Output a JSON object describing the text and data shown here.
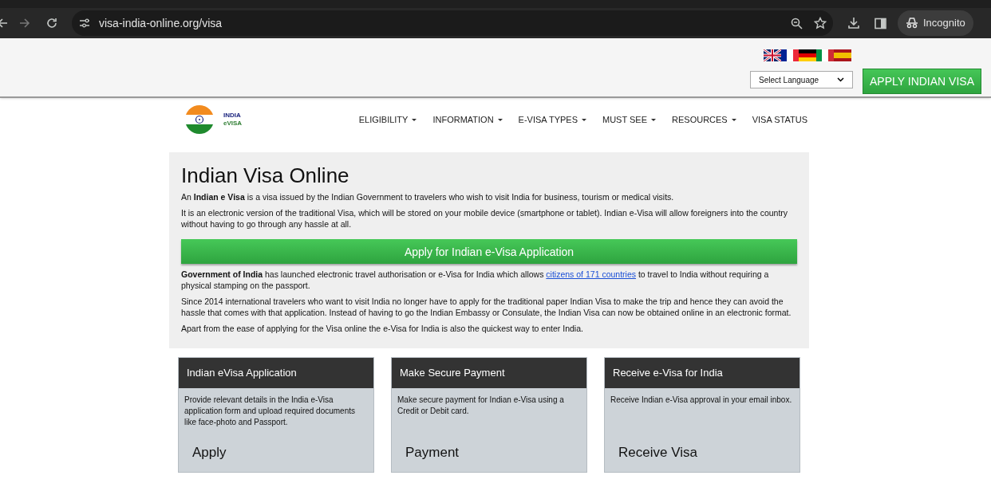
{
  "browser": {
    "url": "visa-india-online.org/visa",
    "profile": "Incognito"
  },
  "header": {
    "language_select": "Select Language",
    "apply_button": "APPLY INDIAN VISA"
  },
  "logo": {
    "line_1": "INDIA",
    "line_2": "eVISA"
  },
  "nav": [
    {
      "label": "ELIGIBILITY",
      "dropdown": true
    },
    {
      "label": "INFORMATION",
      "dropdown": true
    },
    {
      "label": "E-VISA TYPES",
      "dropdown": true
    },
    {
      "label": "MUST SEE",
      "dropdown": true
    },
    {
      "label": "RESOURCES",
      "dropdown": true
    },
    {
      "label": "VISA STATUS",
      "dropdown": false
    }
  ],
  "intro": {
    "title": "Indian Visa Online",
    "paragraphs_top": [
      "An **Indian e Visa** is a visa issued by the Indian Government to travelers who wish to visit India for business, tourism or medical visits.",
      "It is an electronic version of the traditional Visa, which will be stored on your mobile device (smartphone or tablet). Indian e-Visa will allow foreigners into the country without having to go through any hassle at all."
    ],
    "apply_button": "Apply for Indian e-Visa Application",
    "link_paragraph": {
      "before": "**Government of India** has launched electronic travel authorisation or e-Visa for India which allows ",
      "link": "citizens of 171 countries",
      "after": " to travel to India without requiring a physical stamping on the passport."
    },
    "paragraphs_bottom": [
      "Since 2014 international travelers who want to visit India no longer have to apply for the traditional paper Indian Visa to make the trip and hence they can avoid the hassle that comes with that application. Instead of having to go the Indian Embassy or Consulate, the Indian Visa can now be obtained online in an electronic format.",
      "Apart from the ease of applying for the Visa online the e-Visa for India is also the quickest way to enter India."
    ]
  },
  "steps": [
    {
      "title": "Indian eVisa Application",
      "text": "Provide relevant details in the India e-Visa application form and upload required documents like face-photo and Passport.",
      "action": "Apply"
    },
    {
      "title": "Make Secure Payment",
      "text": "Make secure payment for Indian e-Visa using a Credit or Debit card.",
      "action": "Payment"
    },
    {
      "title": "Receive e-Visa for India",
      "text": "Receive Indian e-Visa approval in your email inbox.",
      "action": "Receive Visa"
    }
  ]
}
